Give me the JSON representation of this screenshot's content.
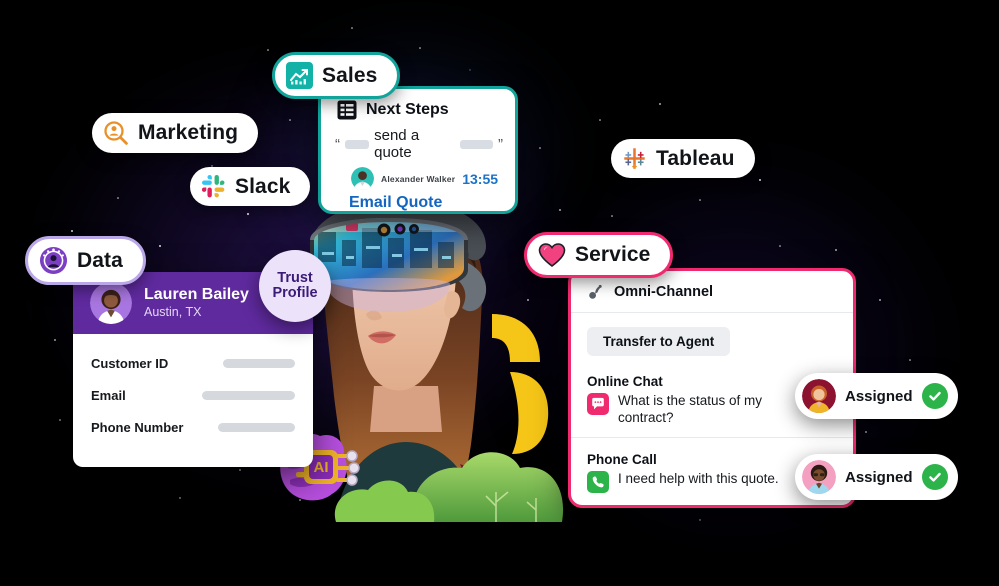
{
  "badges": {
    "sales": {
      "label": "Sales",
      "icon": "sales-chart-icon",
      "accent": "#12a39b"
    },
    "marketing": {
      "label": "Marketing",
      "icon": "marketing-search-person-icon",
      "accent": "#e8912a"
    },
    "slack": {
      "label": "Slack",
      "icon": "slack-icon"
    },
    "data": {
      "label": "Data",
      "icon": "data-person-icon",
      "accent": "#7b3fc4"
    },
    "tableau": {
      "label": "Tableau",
      "icon": "tableau-icon"
    },
    "service": {
      "label": "Service",
      "icon": "service-heart-icon",
      "accent": "#ef2a6e"
    }
  },
  "sales_card": {
    "title": "Next Steps",
    "title_icon": "list-table-icon",
    "quote_open": "“",
    "quote_close": "”",
    "quote_text": "send a quote",
    "author": "Alexander Walker",
    "time": "13:55",
    "cta": "Email Quote",
    "cta_color": "#1266c2"
  },
  "trust_profile": {
    "line1": "Trust",
    "line2": "Profile"
  },
  "data_card": {
    "name": "Lauren Bailey",
    "location": "Austin, TX",
    "header_color": "#5f2a9e",
    "fields": [
      {
        "label": "Customer ID",
        "value_redacted": true
      },
      {
        "label": "Email",
        "value_redacted": true
      },
      {
        "label": "Phone Number",
        "value_redacted": true
      }
    ]
  },
  "service_card": {
    "header": "Omni-Channel",
    "header_icon": "omni-channel-icon",
    "transfer_button": "Transfer to Agent",
    "channels": [
      {
        "title": "Online Chat",
        "icon": "chat-bubble-icon",
        "icon_color": "#ef2a6e",
        "message": "What is the status of my contract?",
        "status": "Assigned"
      },
      {
        "title": "Phone Call",
        "icon": "phone-icon",
        "icon_color": "#2cb34a",
        "message": "I need help with this quote.",
        "status": "Assigned"
      }
    ]
  },
  "chips": [
    {
      "label": "Assigned",
      "status_icon": "check-circle-icon",
      "status_color": "#2cb34a"
    },
    {
      "label": "Assigned",
      "status_icon": "check-circle-icon",
      "status_color": "#2cb34a"
    }
  ],
  "mascot": {
    "label": "AI",
    "icon": "ai-brain-chip-icon"
  },
  "hero": {
    "description": "woman-wearing-ar-headset"
  }
}
